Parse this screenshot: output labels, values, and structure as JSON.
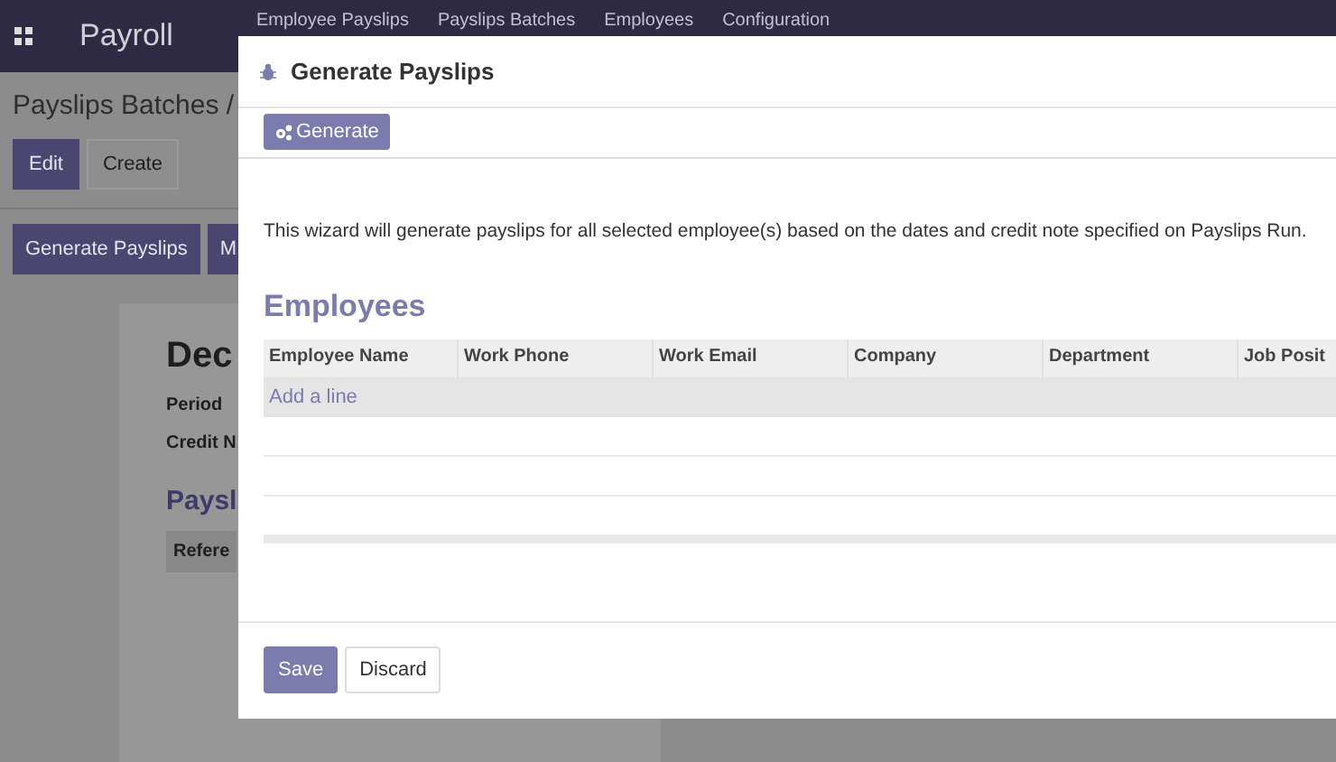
{
  "navbar": {
    "app_title": "Payroll",
    "menu": [
      "Employee Payslips",
      "Payslips Batches",
      "Employees",
      "Configuration"
    ]
  },
  "background": {
    "breadcrumb": "Payslips Batches /",
    "buttons": [
      {
        "label": "Edit",
        "kind": "primary"
      },
      {
        "label": "Create",
        "kind": "secondary"
      }
    ],
    "actions": [
      "Generate Payslips",
      "M"
    ],
    "record_title": "Dec",
    "fields": [
      "Period",
      "Credit N"
    ],
    "section_title": "Paysl",
    "table_header": "Refere"
  },
  "dialog": {
    "title": "Generate Payslips",
    "generate_button": "Generate",
    "description": "This wizard will generate payslips for all selected employee(s) based on the dates and credit note specified on Payslips Run.",
    "section_title": "Employees",
    "columns": [
      "Employee Name",
      "Work Phone",
      "Work Email",
      "Company",
      "Department",
      "Job Posit"
    ],
    "add_line": "Add a line",
    "footer_buttons": [
      {
        "label": "Save",
        "kind": "primary"
      },
      {
        "label": "Discard",
        "kind": "secondary"
      }
    ]
  }
}
